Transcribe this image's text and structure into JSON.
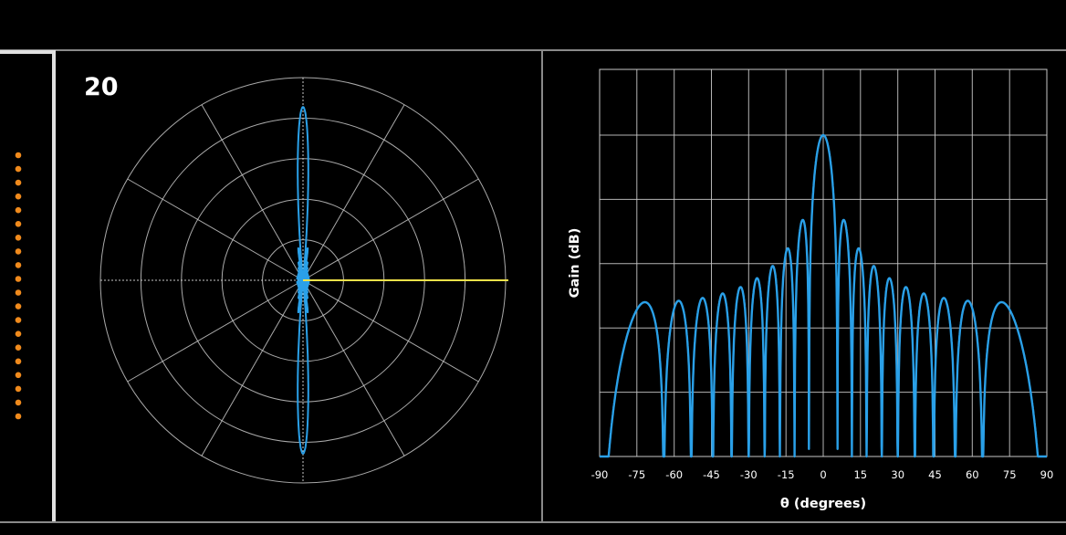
{
  "panel": {
    "element_count_label": "20",
    "element_count": 20,
    "colors": {
      "background": "#000000",
      "pattern": "#2aa0e8",
      "steer_line": "#f2e24a",
      "element_dots": "#f08a1c",
      "grid": "#c8c8c8"
    }
  },
  "array_diagram": {
    "elements": 20,
    "icon": "orange-dot-array"
  },
  "chart_data": [
    {
      "type": "polar",
      "grid_rings": 5,
      "radial_spokes_deg": 30,
      "steer_angle_deg": 0,
      "pattern": "uniform linear array, 20 elements, broadside main lobe",
      "elements": 20
    },
    {
      "type": "line",
      "xlabel": "θ (degrees)",
      "ylabel": "Gain (dB)",
      "x_ticks": [
        "-90",
        "-75",
        "-60",
        "-45",
        "-30",
        "-15",
        "0",
        "15",
        "30",
        "45",
        "60",
        "75",
        "90"
      ],
      "xlim": [
        -90,
        90
      ],
      "ylim": [
        -50,
        0
      ],
      "grid": true,
      "series": [
        {
          "elements": 20,
          "steer_angle_deg": 0
        }
      ]
    }
  ]
}
